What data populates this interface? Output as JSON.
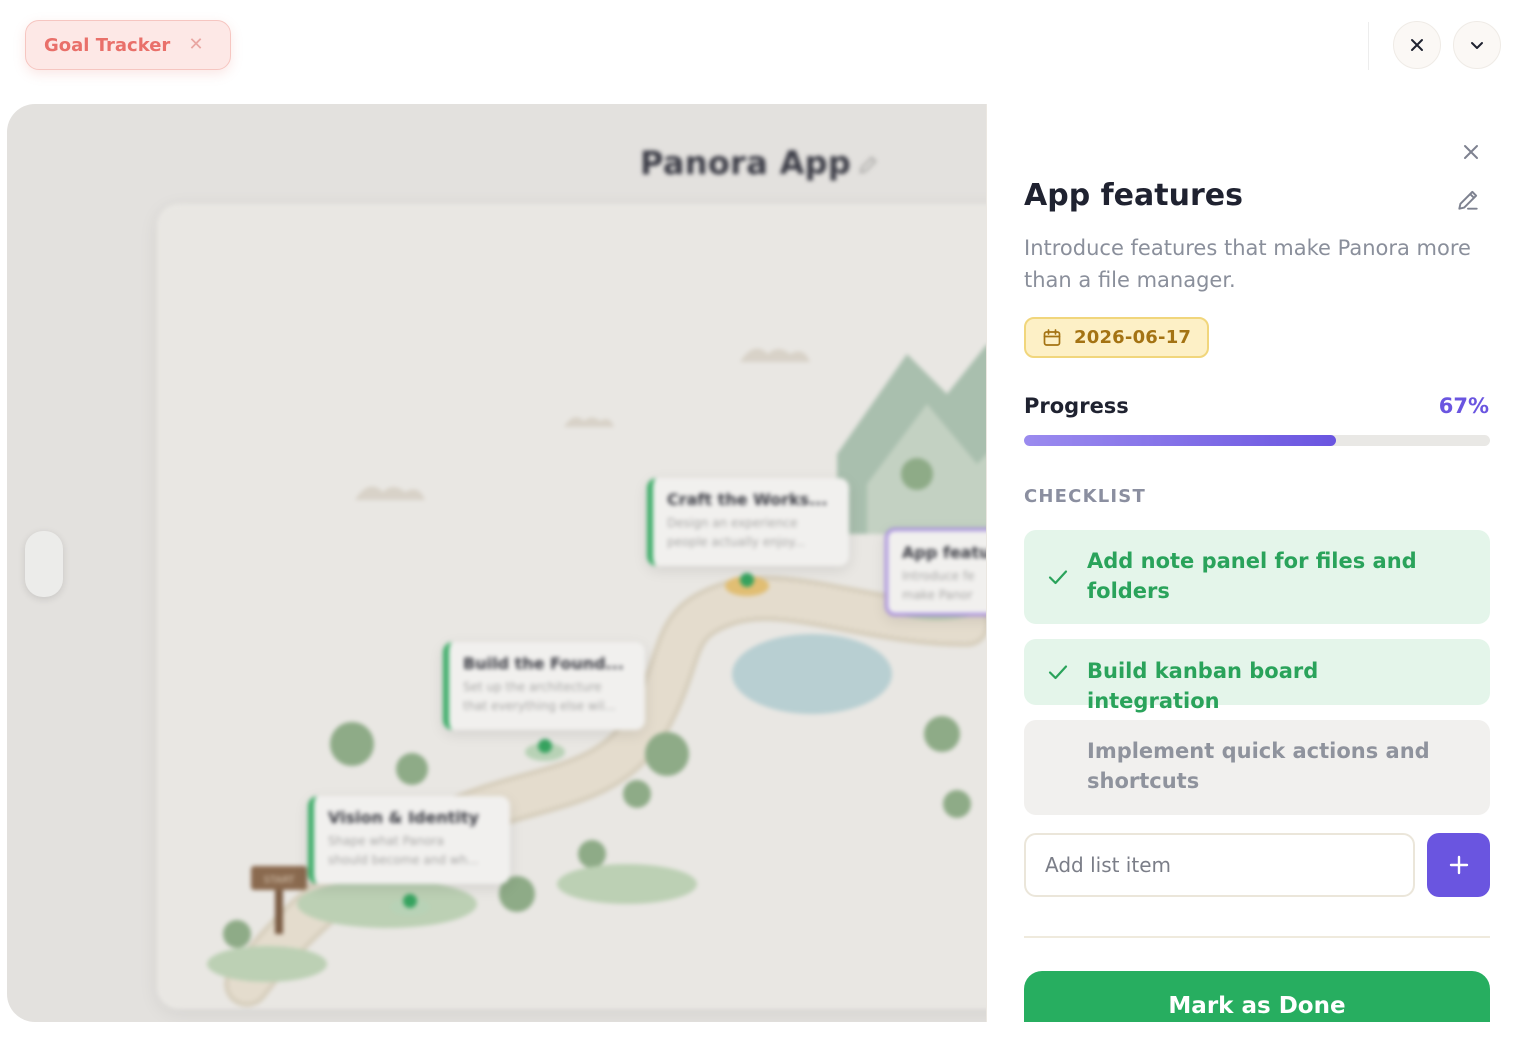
{
  "tab": {
    "label": "Goal Tracker",
    "close_icon": "close-icon"
  },
  "window_controls": {
    "close_icon": "close-icon",
    "collapse_icon": "chevron-down-icon"
  },
  "map": {
    "title": "Panora App",
    "nodes": [
      {
        "title": "Craft the Works...",
        "desc_line1": "Design an experience",
        "desc_line2": "people actually enjoy..."
      },
      {
        "title": "App featu",
        "desc_line1": "Introduce fe",
        "desc_line2": "make Panor"
      },
      {
        "title": "Build the Found...",
        "desc_line1": "Set up the architecture",
        "desc_line2": "that everything else wil..."
      },
      {
        "title": "Vision & Identity",
        "desc_line1": "Shape what Panora",
        "desc_line2": "should become and wh..."
      }
    ],
    "sign_label": "START"
  },
  "panel": {
    "title": "App features",
    "description": "Introduce features that make Panora more than a file manager.",
    "due_date": "2026-06-17",
    "progress_label": "Progress",
    "progress_text": "67%",
    "progress_value": 0.67,
    "checklist_label": "CHECKLIST",
    "checklist": [
      {
        "text": "Add note panel for files and folders",
        "done": true
      },
      {
        "text": "Build kanban board integration",
        "done": true
      },
      {
        "text": "Implement quick actions and shortcuts",
        "done": false
      }
    ],
    "add_placeholder": "Add list item",
    "mark_done_label": "Mark as Done"
  },
  "colors": {
    "accent": "#6a55e0",
    "success": "#27ae60",
    "tab_text": "#e9706a",
    "date_text": "#a47313"
  }
}
